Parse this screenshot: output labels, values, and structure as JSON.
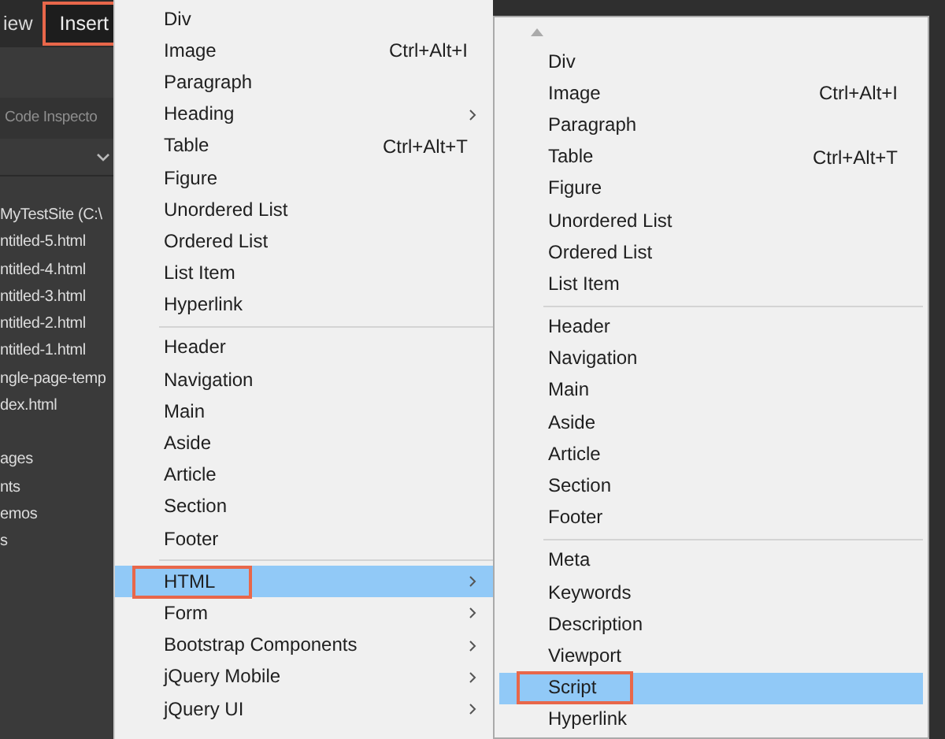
{
  "menu_bar": [
    {
      "label": "iew",
      "callout": false
    },
    {
      "label": "Insert",
      "callout": true
    }
  ],
  "panel": {
    "tab": "Code Inspecto",
    "files": [
      "MyTestSite (C:\\",
      "ntitled-5.html",
      "ntitled-4.html",
      "ntitled-3.html",
      "ntitled-2.html",
      "ntitled-1.html",
      "ngle-page-temp",
      "dex.html"
    ],
    "assets": [
      "ages",
      "nts",
      "emos",
      "s"
    ]
  },
  "insert_menu": {
    "items": [
      {
        "kind": "item",
        "label": "Div",
        "submenu": false,
        "selected": false,
        "callout": false
      },
      {
        "kind": "item",
        "label": "Image",
        "shortcut": "Ctrl+Alt+I",
        "submenu": false,
        "selected": false,
        "callout": false
      },
      {
        "kind": "item",
        "label": "Paragraph",
        "submenu": false,
        "selected": false,
        "callout": false
      },
      {
        "kind": "item",
        "label": "Heading",
        "submenu": true,
        "selected": false,
        "callout": false
      },
      {
        "kind": "item",
        "label": "Table",
        "shortcut": "Ctrl+Alt+T",
        "submenu": false,
        "selected": false,
        "callout": false
      },
      {
        "kind": "item",
        "label": "Figure",
        "submenu": false,
        "selected": false,
        "callout": false
      },
      {
        "kind": "item",
        "label": "Unordered List",
        "submenu": false,
        "selected": false,
        "callout": false
      },
      {
        "kind": "item",
        "label": "Ordered List",
        "submenu": false,
        "selected": false,
        "callout": false
      },
      {
        "kind": "item",
        "label": "List Item",
        "submenu": false,
        "selected": false,
        "callout": false
      },
      {
        "kind": "item",
        "label": "Hyperlink",
        "submenu": false,
        "selected": false,
        "callout": false
      },
      {
        "kind": "separator"
      },
      {
        "kind": "item",
        "label": "Header",
        "submenu": false,
        "selected": false,
        "callout": false
      },
      {
        "kind": "item",
        "label": "Navigation",
        "submenu": false,
        "selected": false,
        "callout": false
      },
      {
        "kind": "item",
        "label": "Main",
        "submenu": false,
        "selected": false,
        "callout": false
      },
      {
        "kind": "item",
        "label": "Aside",
        "submenu": false,
        "selected": false,
        "callout": false
      },
      {
        "kind": "item",
        "label": "Article",
        "submenu": false,
        "selected": false,
        "callout": false
      },
      {
        "kind": "item",
        "label": "Section",
        "submenu": false,
        "selected": false,
        "callout": false
      },
      {
        "kind": "item",
        "label": "Footer",
        "submenu": false,
        "selected": false,
        "callout": false
      },
      {
        "kind": "separator"
      },
      {
        "kind": "item",
        "label": "HTML",
        "submenu": true,
        "selected": true,
        "callout": true
      },
      {
        "kind": "item",
        "label": "Form",
        "submenu": true,
        "selected": false,
        "callout": false
      },
      {
        "kind": "item",
        "label": "Bootstrap Components",
        "submenu": true,
        "selected": false,
        "callout": false
      },
      {
        "kind": "item",
        "label": "jQuery Mobile",
        "submenu": true,
        "selected": false,
        "callout": false
      },
      {
        "kind": "item",
        "label": "jQuery UI",
        "submenu": true,
        "selected": false,
        "callout": false
      }
    ]
  },
  "html_submenu": {
    "items": [
      {
        "kind": "item",
        "label": "Div",
        "submenu": false,
        "selected": false,
        "callout": false
      },
      {
        "kind": "item",
        "label": "Image",
        "shortcut": "Ctrl+Alt+I",
        "submenu": false,
        "selected": false,
        "callout": false
      },
      {
        "kind": "item",
        "label": "Paragraph",
        "submenu": false,
        "selected": false,
        "callout": false
      },
      {
        "kind": "item",
        "label": "Table",
        "shortcut": "Ctrl+Alt+T",
        "submenu": false,
        "selected": false,
        "callout": false
      },
      {
        "kind": "item",
        "label": "Figure",
        "submenu": false,
        "selected": false,
        "callout": false
      },
      {
        "kind": "item",
        "label": "Unordered List",
        "submenu": false,
        "selected": false,
        "callout": false
      },
      {
        "kind": "item",
        "label": "Ordered List",
        "submenu": false,
        "selected": false,
        "callout": false
      },
      {
        "kind": "item",
        "label": "List Item",
        "submenu": false,
        "selected": false,
        "callout": false
      },
      {
        "kind": "separator"
      },
      {
        "kind": "item",
        "label": "Header",
        "submenu": false,
        "selected": false,
        "callout": false
      },
      {
        "kind": "item",
        "label": "Navigation",
        "submenu": false,
        "selected": false,
        "callout": false
      },
      {
        "kind": "item",
        "label": "Main",
        "submenu": false,
        "selected": false,
        "callout": false
      },
      {
        "kind": "item",
        "label": "Aside",
        "submenu": false,
        "selected": false,
        "callout": false
      },
      {
        "kind": "item",
        "label": "Article",
        "submenu": false,
        "selected": false,
        "callout": false
      },
      {
        "kind": "item",
        "label": "Section",
        "submenu": false,
        "selected": false,
        "callout": false
      },
      {
        "kind": "item",
        "label": "Footer",
        "submenu": false,
        "selected": false,
        "callout": false
      },
      {
        "kind": "separator"
      },
      {
        "kind": "item",
        "label": "Meta",
        "submenu": false,
        "selected": false,
        "callout": false
      },
      {
        "kind": "item",
        "label": "Keywords",
        "submenu": false,
        "selected": false,
        "callout": false
      },
      {
        "kind": "item",
        "label": "Description",
        "submenu": false,
        "selected": false,
        "callout": false
      },
      {
        "kind": "item",
        "label": "Viewport",
        "submenu": false,
        "selected": false,
        "callout": false
      },
      {
        "kind": "item",
        "label": "Script",
        "submenu": false,
        "selected": true,
        "callout": true
      },
      {
        "kind": "item",
        "label": "Hyperlink",
        "submenu": false,
        "selected": false,
        "callout": false
      }
    ]
  }
}
